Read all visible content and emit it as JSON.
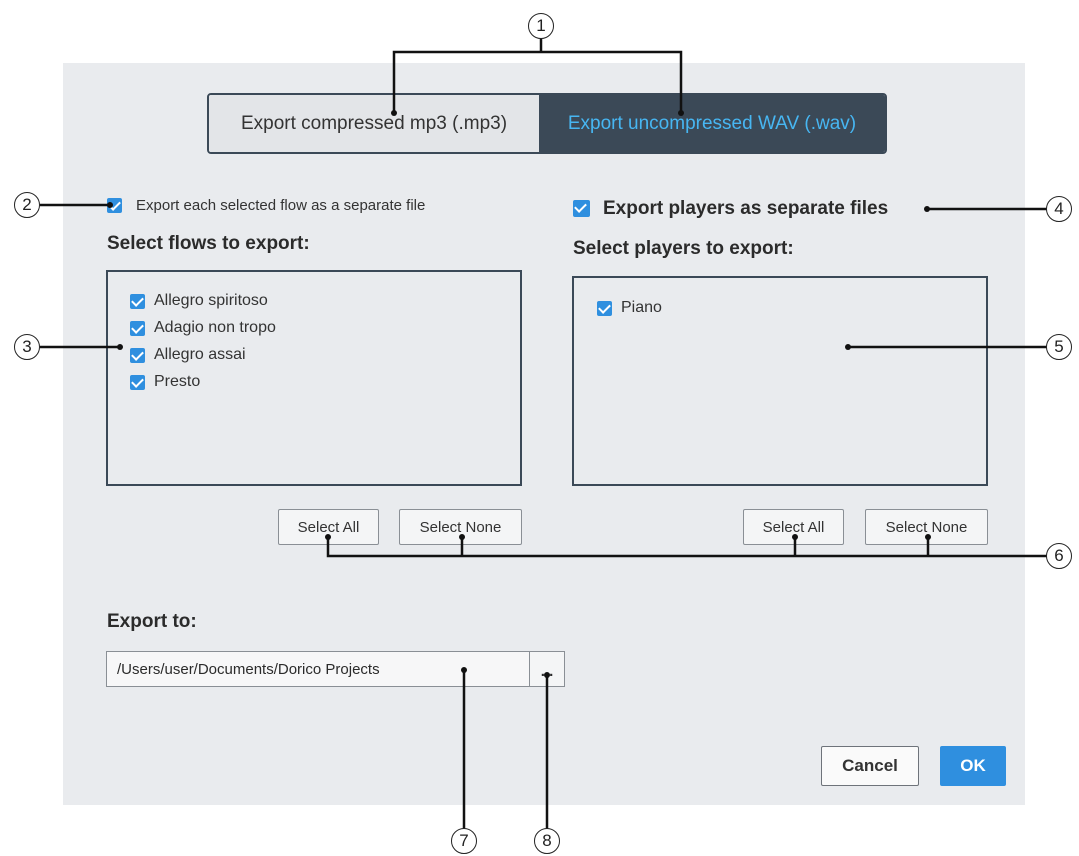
{
  "tabs": {
    "mp3": "Export compressed mp3 (.mp3)",
    "wav": "Export uncompressed WAV (.wav)"
  },
  "flows_option": {
    "label": "Export each selected flow as a separate file",
    "checked": true
  },
  "players_option": {
    "label": "Export players as separate files",
    "checked": true
  },
  "flows": {
    "heading": "Select flows to export:",
    "items": [
      "Allegro spiritoso",
      "Adagio non tropo",
      "Allegro assai",
      "Presto"
    ],
    "select_all": "Select All",
    "select_none": "Select None"
  },
  "players": {
    "heading": "Select players to export:",
    "items": [
      "Piano"
    ],
    "select_all": "Select All",
    "select_none": "Select None"
  },
  "export_to": {
    "heading": "Export to:",
    "path": "/Users/user/Documents/Dorico Projects",
    "browse": "..."
  },
  "footer": {
    "cancel": "Cancel",
    "ok": "OK"
  },
  "callouts": [
    "1",
    "2",
    "3",
    "4",
    "5",
    "6",
    "7",
    "8"
  ],
  "colors": {
    "accent": "#2f8fdf",
    "segment_dark": "#3b4957",
    "segment_text": "#47b6f2",
    "dialog_bg": "#e9ebee"
  }
}
